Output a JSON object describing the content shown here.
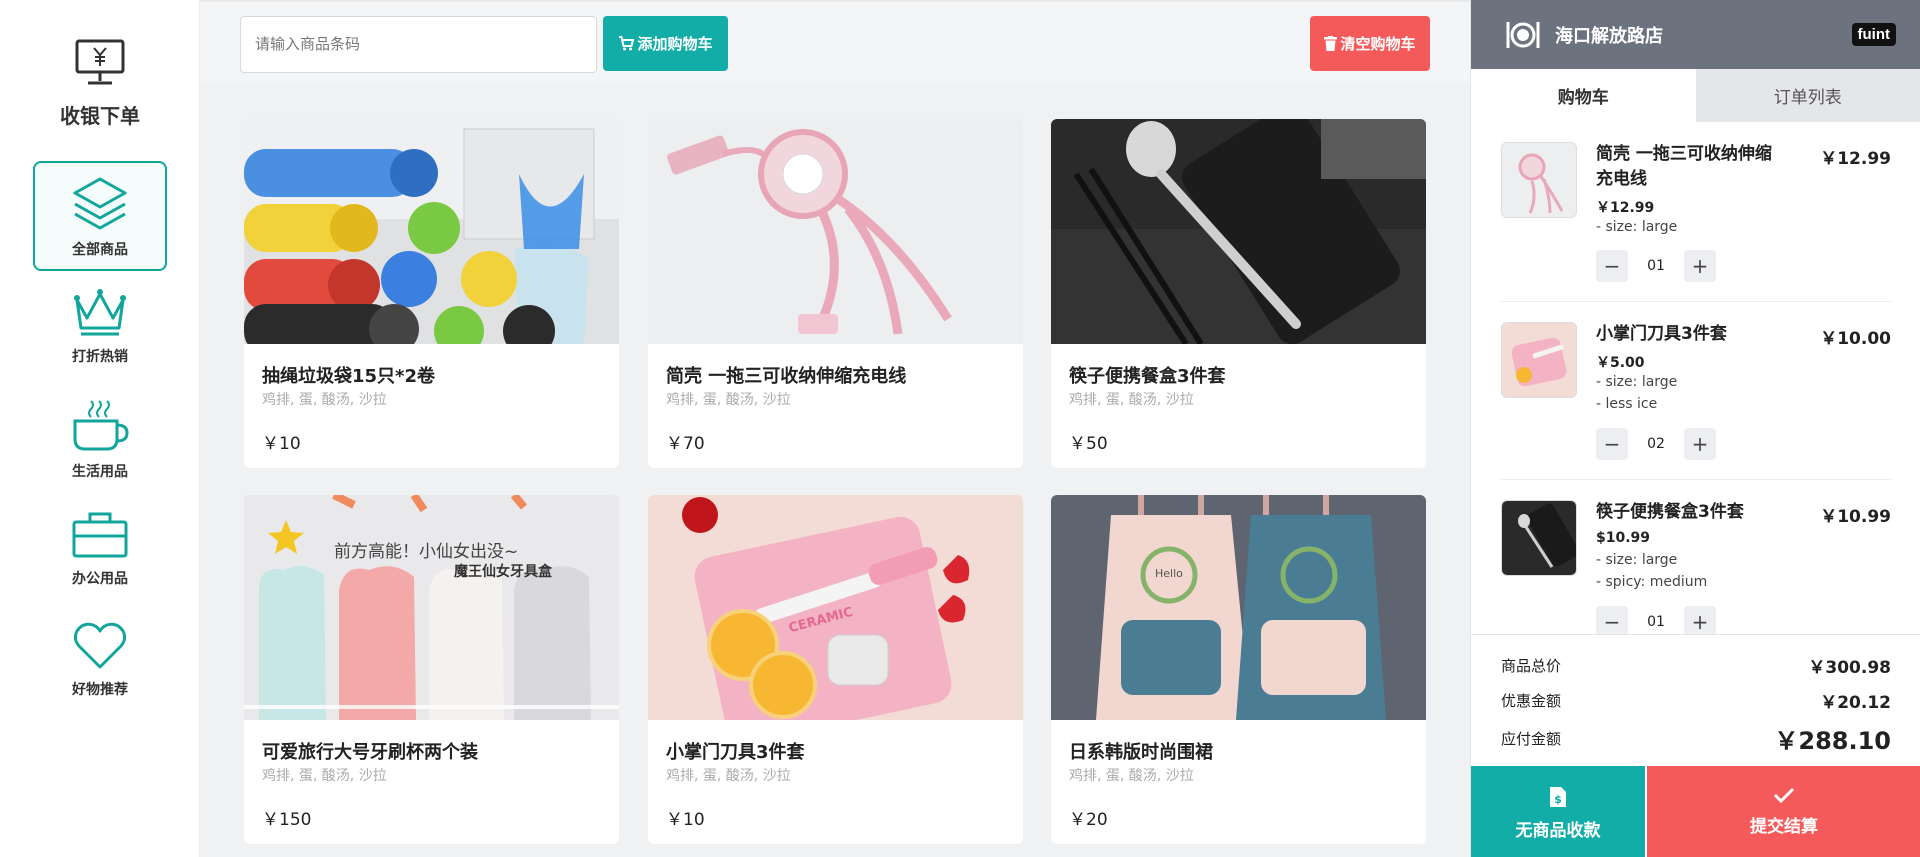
{
  "sidebar": {
    "title": "收银下单",
    "items": [
      {
        "label": "全部商品",
        "icon": "layers-icon",
        "active": true
      },
      {
        "label": "打折热销",
        "icon": "crown-icon",
        "active": false
      },
      {
        "label": "生活用品",
        "icon": "coffee-cup-icon",
        "active": false
      },
      {
        "label": "办公用品",
        "icon": "briefcase-icon",
        "active": false
      },
      {
        "label": "好物推荐",
        "icon": "heart-icon",
        "active": false
      }
    ]
  },
  "topbar": {
    "search_placeholder": "请输入商品条码",
    "add_button": "添加购物车",
    "clear_button": "清空购物车"
  },
  "products": [
    {
      "name": "抽绳垃圾袋15只*2卷",
      "desc": "鸡排, 蛋, 酸汤, 沙拉",
      "price": "￥10"
    },
    {
      "name": "简壳 一拖三可收纳伸缩充电线",
      "desc": "鸡排, 蛋, 酸汤, 沙拉",
      "price": "￥70"
    },
    {
      "name": "筷子便携餐盒3件套",
      "desc": "鸡排, 蛋, 酸汤, 沙拉",
      "price": "￥50"
    },
    {
      "name": "可爱旅行大号牙刷杯两个装",
      "desc": "鸡排, 蛋, 酸汤, 沙拉",
      "price": "￥150",
      "img_text": "前方高能！小仙女出没~",
      "img_subtext": "魔王仙女牙具盒"
    },
    {
      "name": "小掌门刀具3件套",
      "desc": "鸡排, 蛋, 酸汤, 沙拉",
      "price": "￥10",
      "img_text": "CERAMIC"
    },
    {
      "name": "日系韩版时尚围裙",
      "desc": "鸡排, 蛋, 酸汤, 沙拉",
      "price": "￥20",
      "img_text": "Hello"
    }
  ],
  "cart": {
    "shop_name": "海口解放路店",
    "badge": "fuint",
    "tabs": [
      "购物车",
      "订单列表"
    ],
    "items": [
      {
        "name": "简壳 一拖三可收纳伸缩充电线",
        "total": "￥12.99",
        "unit_price": "￥12.99",
        "options": [
          "- size: large"
        ],
        "qty": "01"
      },
      {
        "name": "小掌门刀具3件套",
        "total": "￥10.00",
        "unit_price": "￥5.00",
        "options": [
          "- size: large",
          "- less ice"
        ],
        "qty": "02"
      },
      {
        "name": "筷子便携餐盒3件套",
        "total": "￥10.99",
        "unit_price": "$10.99",
        "options": [
          "- size: large",
          "- spicy: medium"
        ],
        "qty": "01"
      }
    ],
    "summary": {
      "total_label": "商品总价",
      "total": "￥300.98",
      "discount_label": "优惠金额",
      "discount": "￥20.12",
      "payable_label": "应付金额",
      "payable": "￥288.10"
    },
    "buttons": {
      "no_product": "无商品收款",
      "submit": "提交结算"
    }
  },
  "colors": {
    "accent": "#12ada6",
    "danger": "#f55a5a",
    "shop_bar": "#6c737e"
  }
}
